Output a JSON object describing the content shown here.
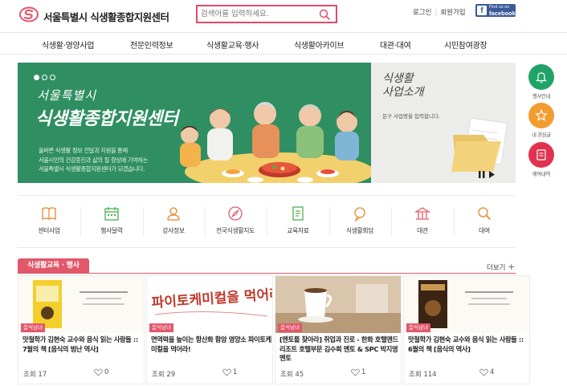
{
  "header": {
    "site_title": "서울특별시 식생활종합지원센터",
    "search_placeholder": "검색어를 입력하세요.",
    "util": {
      "login": "로그인",
      "join": "회원가입"
    },
    "facebook": {
      "small": "Find us on",
      "big": "facebook"
    }
  },
  "nav": [
    "식생활·영양사업",
    "전문인력정보",
    "식생활교육·행사",
    "식생활아카이브",
    "대관·대여",
    "시민참여광장"
  ],
  "banner": {
    "line1": "서울특별시",
    "line2": "식생활종합지원센터",
    "desc": [
      "올바른 식생활 정보 전달과 지원을 통해",
      "서울시민의 건강증진과 삶의 질 향상에 기여하는",
      "서울특별시 식생활종합지원센터가 되겠습니다."
    ]
  },
  "intro": {
    "title_1": "식생활",
    "title_2": "사업소개",
    "desc": "문구 사업명을 입력합니다."
  },
  "quick_menu": [
    "센터사업",
    "행사달력",
    "강사정보",
    "전국식생활지도",
    "교육자료",
    "식생활회담",
    "대관",
    "대여"
  ],
  "side_bar": [
    "행사안내",
    "내 관심글",
    "예약내역"
  ],
  "section": {
    "title": "식생활교육 · 행사",
    "more": "더보기"
  },
  "cards": [
    {
      "badge": "음식남녀",
      "title": "맛철학가 김현숙 교수와 음식 읽는 사람들 :: 7월의 책 [음식의 범난 역사]",
      "views": "조회 17",
      "likes": "0"
    },
    {
      "badge": "음식남녀",
      "title": "면역력을 높이는 항산화 함암 영양소 파이토케미컬을 먹어라!",
      "views": "조회 29",
      "likes": "1"
    },
    {
      "badge": "음식남녀",
      "title": "[멘토를 찾아라] 취업과 진로 - 한화 호텔앤드리조트 호텔부문 김수희 멘토 & SPC 박지영 멘토",
      "views": "조회 45",
      "likes": "1"
    },
    {
      "badge": "음식남녀",
      "title": "맛철학가 김현숙 교수와 음식 읽는 사람들 :: 6월의 책 [음식의 역사]",
      "views": "조회 114",
      "likes": "4"
    }
  ],
  "card_thumbs": {
    "card2_text": "파이토케미컬을 먹어라"
  },
  "colors": {
    "accent": "#e2576a",
    "search_border": "#e24a67",
    "banner_green": "#2f8f62",
    "side_green": "#1fa366",
    "side_orange": "#f39c2f",
    "side_red": "#e0334f"
  }
}
